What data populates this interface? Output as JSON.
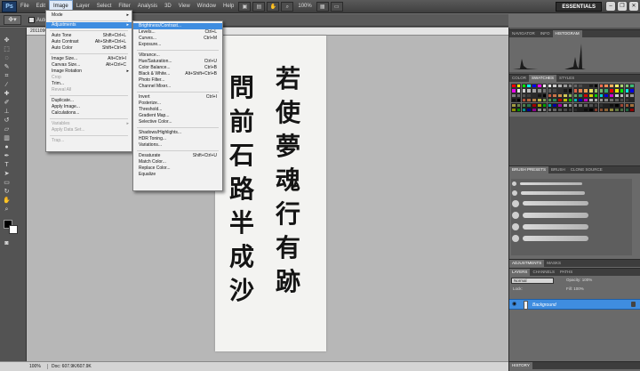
{
  "app": {
    "logo": "Ps",
    "essentials": "ESSENTIALS"
  },
  "menubar": {
    "items": [
      "File",
      "Edit",
      "Image",
      "Layer",
      "Select",
      "Filter",
      "Analysis",
      "3D",
      "View",
      "Window",
      "Help"
    ],
    "zoom": "100%"
  },
  "options": {
    "autoselect": "Auto-Se"
  },
  "document": {
    "tab": "20110909...",
    "status_zoom": "100%",
    "status_doc": "Doc: 607.9K/607.9K",
    "calligraphy_right": [
      "若",
      "使",
      "夢",
      "魂",
      "行",
      "有",
      "跡"
    ],
    "calligraphy_left": [
      "問",
      "前",
      "石",
      "路",
      "半",
      "成",
      "沙"
    ]
  },
  "image_menu": {
    "items": [
      {
        "label": "Mode",
        "shortcut": "",
        "arrow": true,
        "state": "normal"
      },
      {
        "label": "Adjustments",
        "shortcut": "",
        "arrow": true,
        "state": "highlight"
      },
      {
        "label": "Auto Tone",
        "shortcut": "Shift+Ctrl+L",
        "arrow": false,
        "state": "normal"
      },
      {
        "label": "Auto Contrast",
        "shortcut": "Alt+Shift+Ctrl+L",
        "arrow": false,
        "state": "normal"
      },
      {
        "label": "Auto Color",
        "shortcut": "Shift+Ctrl+B",
        "arrow": false,
        "state": "normal"
      },
      {
        "label": "Image Size...",
        "shortcut": "Alt+Ctrl+I",
        "arrow": false,
        "state": "normal"
      },
      {
        "label": "Canvas Size...",
        "shortcut": "Alt+Ctrl+C",
        "arrow": false,
        "state": "normal"
      },
      {
        "label": "Image Rotation",
        "shortcut": "",
        "arrow": true,
        "state": "normal"
      },
      {
        "label": "Crop",
        "shortcut": "",
        "arrow": false,
        "state": "disabled"
      },
      {
        "label": "Trim...",
        "shortcut": "",
        "arrow": false,
        "state": "normal"
      },
      {
        "label": "Reveal All",
        "shortcut": "",
        "arrow": false,
        "state": "disabled"
      },
      {
        "label": "Duplicate...",
        "shortcut": "",
        "arrow": false,
        "state": "normal"
      },
      {
        "label": "Apply Image...",
        "shortcut": "",
        "arrow": false,
        "state": "normal"
      },
      {
        "label": "Calculations...",
        "shortcut": "",
        "arrow": false,
        "state": "normal"
      },
      {
        "label": "Variables",
        "shortcut": "",
        "arrow": true,
        "state": "disabled"
      },
      {
        "label": "Apply Data Set...",
        "shortcut": "",
        "arrow": false,
        "state": "disabled"
      },
      {
        "label": "Trap...",
        "shortcut": "",
        "arrow": false,
        "state": "disabled"
      }
    ]
  },
  "adjust_menu": {
    "items": [
      {
        "label": "Brightness/Contrast...",
        "shortcut": "",
        "state": "highlight"
      },
      {
        "label": "Levels...",
        "shortcut": "Ctrl+L",
        "state": "normal"
      },
      {
        "label": "Curves...",
        "shortcut": "Ctrl+M",
        "state": "normal"
      },
      {
        "label": "Exposure...",
        "shortcut": "",
        "state": "normal"
      },
      {
        "label": "Vibrance...",
        "shortcut": "",
        "state": "normal"
      },
      {
        "label": "Hue/Saturation...",
        "shortcut": "Ctrl+U",
        "state": "normal"
      },
      {
        "label": "Color Balance...",
        "shortcut": "Ctrl+B",
        "state": "normal"
      },
      {
        "label": "Black & White...",
        "shortcut": "Alt+Shift+Ctrl+B",
        "state": "normal"
      },
      {
        "label": "Photo Filter...",
        "shortcut": "",
        "state": "normal"
      },
      {
        "label": "Channel Mixer...",
        "shortcut": "",
        "state": "normal"
      },
      {
        "label": "Invert",
        "shortcut": "Ctrl+I",
        "state": "normal"
      },
      {
        "label": "Posterize...",
        "shortcut": "",
        "state": "normal"
      },
      {
        "label": "Threshold...",
        "shortcut": "",
        "state": "normal"
      },
      {
        "label": "Gradient Map...",
        "shortcut": "",
        "state": "normal"
      },
      {
        "label": "Selective Color...",
        "shortcut": "",
        "state": "normal"
      },
      {
        "label": "Shadows/Highlights...",
        "shortcut": "",
        "state": "normal"
      },
      {
        "label": "HDR Toning...",
        "shortcut": "",
        "state": "normal"
      },
      {
        "label": "Variations...",
        "shortcut": "",
        "state": "normal"
      },
      {
        "label": "Desaturate",
        "shortcut": "Shift+Ctrl+U",
        "state": "normal"
      },
      {
        "label": "Match Color...",
        "shortcut": "",
        "state": "normal"
      },
      {
        "label": "Replace Color...",
        "shortcut": "",
        "state": "normal"
      },
      {
        "label": "Equalize",
        "shortcut": "",
        "state": "normal"
      }
    ]
  },
  "panels": {
    "navigator_tabs": [
      "NAVIGATOR",
      "INFO",
      "HISTOGRAM"
    ],
    "color_tabs": [
      "COLOR",
      "SWATCHES",
      "STYLES"
    ],
    "brush_tabs": [
      "BRUSH PRESETS",
      "BRUSH",
      "CLONE SOURCE"
    ],
    "adjust_tabs": [
      "ADJUSTMENTS",
      "MASKS"
    ],
    "layers_tabs": [
      "LAYERS",
      "CHANNELS",
      "PATHS"
    ],
    "blend_mode": "Normal",
    "opacity": "Opacity: 100%",
    "lock_label": "Lock:",
    "fill": "Fill: 100%",
    "layer_name": "Background",
    "history_tab": "HISTORY"
  },
  "colors": {
    "swatches": [
      "#ff0000",
      "#ffff00",
      "#00ff00",
      "#00ffff",
      "#0000ff",
      "#ff00ff",
      "#ffffff",
      "#e6e6e6",
      "#cccccc",
      "#b3b3b3",
      "#999999",
      "#808080",
      "#666666",
      "#4d4d4d",
      "#333333",
      "#1a1a1a",
      "#000000",
      "#f26c4f",
      "#f68e56",
      "#fbaf5d",
      "#fff568",
      "#acd372",
      "#7cc576",
      "#3bb878"
    ]
  }
}
